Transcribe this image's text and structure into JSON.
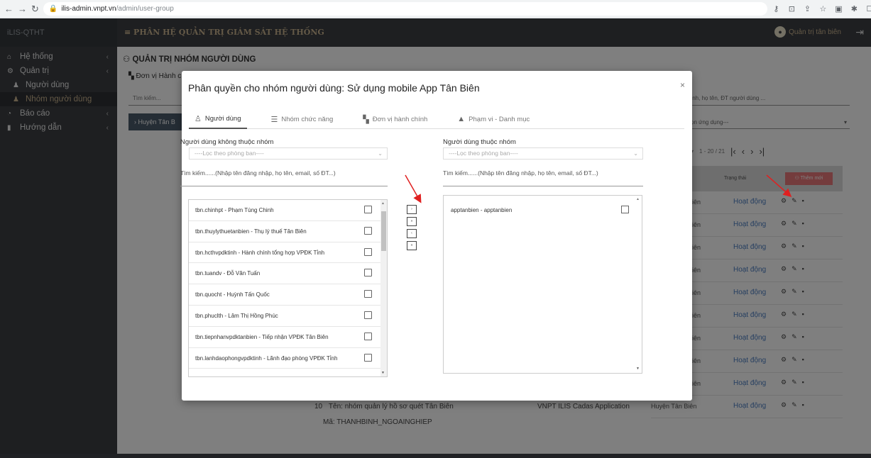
{
  "browser": {
    "url_host": "ilis-admin.vnpt.vn",
    "url_path": "/admin/user-group"
  },
  "header": {
    "brand": "iLIS-QTHT",
    "title": "≡ PHÂN HỆ QUẢN TRỊ GIÁM SÁT HỆ THỐNG",
    "user": "Quản trị tân biên"
  },
  "sidebar": {
    "items": [
      {
        "label": "Hệ thống",
        "icon": "home-icon"
      },
      {
        "label": "Quản trị",
        "icon": "gears-icon"
      },
      {
        "label": "Người dùng",
        "icon": "user-icon"
      },
      {
        "label": "Nhóm người dùng",
        "icon": "users-icon"
      },
      {
        "label": "Báo cáo",
        "icon": "chart-icon"
      },
      {
        "label": "Hướng dẫn",
        "icon": "book-icon"
      }
    ]
  },
  "main": {
    "page_title": "QUẢN TRỊ NHÓM NGƯỜI DÙNG",
    "unit_label": "Đơn vị Hành c",
    "search_placeholder": "Tìm kiếm...",
    "huyen_label": "Huyện Tân B",
    "right_search": "ình, họ tên, ĐT người dùng ...",
    "right_select": "ọn ứng dụng---",
    "pager_range": "1 - 20 / 21",
    "col_status": "Trạng thái",
    "add_button": "Thêm mới",
    "rows": [
      {
        "dv": "iên",
        "status": "Hoạt động"
      },
      {
        "dv": "iên",
        "status": "Hoạt động"
      },
      {
        "dv": "iên",
        "status": "Hoạt động"
      },
      {
        "dv": "iên",
        "status": "Hoạt động"
      },
      {
        "dv": "iên",
        "status": "Hoạt động"
      },
      {
        "dv": "iên",
        "status": "Hoạt động"
      },
      {
        "dv": "iên",
        "status": "Hoạt động"
      },
      {
        "dv": "iên",
        "status": "Hoạt động"
      },
      {
        "dv": "iên",
        "status": "Hoạt động"
      },
      {
        "dv": "Huyện Tân Biên",
        "status": "Hoạt động"
      }
    ],
    "bottom_rows": [
      {
        "no": "10",
        "name": "Tên: nhóm quản lý hồ sơ quét Tân Biên",
        "app": "VNPT ILIS Cadas Application"
      },
      {
        "code": "Mã: THANHBINH_NGOAINGHIEP"
      }
    ]
  },
  "modal": {
    "title": "Phân quyền cho nhóm người dùng: Sử dụng mobile App Tân Biên",
    "tabs": [
      {
        "label": "Người dùng",
        "icon": "user-outline-icon"
      },
      {
        "label": "Nhóm chức năng",
        "icon": "list-icon"
      },
      {
        "label": "Đơn vị hành chính",
        "icon": "org-chart-icon"
      },
      {
        "label": "Phạm vi - Danh mục",
        "icon": "shapes-icon"
      }
    ],
    "left": {
      "title": "Người dùng không thuộc nhóm",
      "filter_placeholder": "----Lọc theo phòng ban----",
      "search_hint": "Tìm kiếm......(Nhập tên đăng nhập, họ tên, email, số ĐT...)",
      "items": [
        "tbn.chinhpt - Phạm Tùng Chinh",
        "tbn.thuylythuetanbien - Thụ lý thuế Tân Biên",
        "tbn.hcthvpdktinh - Hành chính tổng hợp VPĐK Tỉnh",
        "tbn.tuandv - Đỗ Văn Tuấn",
        "tbn.quocht - Huỳnh Tấn Quốc",
        "tbn.phuclth - Lâm Thị Hồng Phúc",
        "tbn.tiepnhanvpdktanbien - Tiếp nhận VPĐK Tân Biên",
        "tbn.lanhdaophongvpdktinh - Lãnh đạo phòng VPĐK Tỉnh"
      ]
    },
    "right": {
      "title": "Người dùng thuộc nhóm",
      "filter_placeholder": "----Lọc theo phòng ban----",
      "search_hint": "Tìm kiếm......(Nhập tên đăng nhập, họ tên, email, số ĐT...)",
      "items": [
        "apptanbien - apptanbien"
      ]
    },
    "move_buttons": [
      "›",
      "»",
      "‹",
      "«"
    ]
  },
  "colors": {
    "sidebar_bg": "#3c3f43",
    "accent_gold": "#c9b38f",
    "status_blue": "#4a7cc0",
    "add_btn": "#e9787a",
    "annotation_red": "#e02020"
  }
}
